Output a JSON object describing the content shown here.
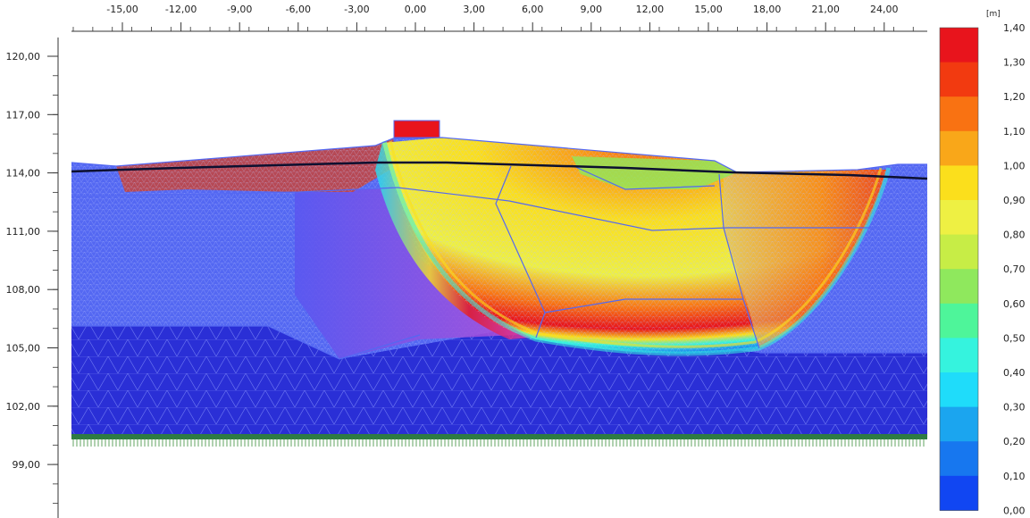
{
  "x_axis": {
    "labels": [
      "-15,00",
      "-12,00",
      "-9,00",
      "-6,00",
      "-3,00",
      "0,00",
      "3,00",
      "6,00",
      "9,00",
      "12,00",
      "15,00",
      "18,00",
      "21,00",
      "24,00"
    ]
  },
  "y_axis": {
    "labels": [
      "120,00",
      "117,00",
      "114,00",
      "111,00",
      "108,00",
      "105,00",
      "102,00",
      "99,00"
    ]
  },
  "legend": {
    "unit": "[m]",
    "labels": [
      "1,40",
      "1,30",
      "1,20",
      "1,10",
      "1,00",
      "0,90",
      "0,80",
      "0,70",
      "0,60",
      "0,50",
      "0,40",
      "0,30",
      "0,20",
      "0,10",
      "0,00"
    ],
    "colors": [
      "#e8141c",
      "#f23a10",
      "#f97212",
      "#f9a719",
      "#fbdf1c",
      "#eef043",
      "#c7ed46",
      "#8fe85d",
      "#4ef59a",
      "#35f3de",
      "#1fdcfa",
      "#1ba5ef",
      "#1777ef",
      "#1146f2",
      "#0a1ff4"
    ]
  },
  "colors": {
    "mesh_light": "#7c8cff",
    "soil_dark": "#2a2fd6",
    "phreatic_line": "#0c1030",
    "boundary": "#3a8d3a"
  }
}
